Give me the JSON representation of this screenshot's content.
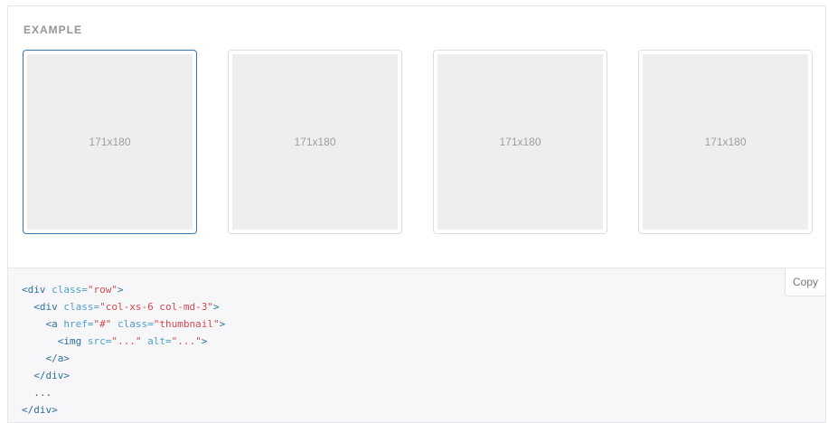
{
  "example": {
    "label": "EXAMPLE",
    "thumbnails": [
      {
        "text": "171x180",
        "active": true
      },
      {
        "text": "171x180",
        "active": false
      },
      {
        "text": "171x180",
        "active": false
      },
      {
        "text": "171x180",
        "active": false
      }
    ]
  },
  "code_block": {
    "copy_label": "Copy",
    "lines": [
      [
        {
          "t": "tag",
          "v": "<div "
        },
        {
          "t": "attr",
          "v": "class="
        },
        {
          "t": "str",
          "v": "\"row\""
        },
        {
          "t": "tag",
          "v": ">"
        }
      ],
      [
        {
          "t": "plain",
          "v": "  "
        },
        {
          "t": "tag",
          "v": "<div "
        },
        {
          "t": "attr",
          "v": "class="
        },
        {
          "t": "str",
          "v": "\"col-xs-6 col-md-3\""
        },
        {
          "t": "tag",
          "v": ">"
        }
      ],
      [
        {
          "t": "plain",
          "v": "    "
        },
        {
          "t": "tag",
          "v": "<a "
        },
        {
          "t": "attr",
          "v": "href="
        },
        {
          "t": "str",
          "v": "\"#\""
        },
        {
          "t": "attr",
          "v": " class="
        },
        {
          "t": "str",
          "v": "\"thumbnail\""
        },
        {
          "t": "tag",
          "v": ">"
        }
      ],
      [
        {
          "t": "plain",
          "v": "      "
        },
        {
          "t": "tag",
          "v": "<img "
        },
        {
          "t": "attr",
          "v": "src="
        },
        {
          "t": "str",
          "v": "\"...\""
        },
        {
          "t": "attr",
          "v": " alt="
        },
        {
          "t": "str",
          "v": "\"...\""
        },
        {
          "t": "tag",
          "v": ">"
        }
      ],
      [
        {
          "t": "plain",
          "v": "    "
        },
        {
          "t": "tag",
          "v": "</a>"
        }
      ],
      [
        {
          "t": "plain",
          "v": "  "
        },
        {
          "t": "tag",
          "v": "</div>"
        }
      ],
      [
        {
          "t": "plain",
          "v": "  ..."
        }
      ],
      [
        {
          "t": "tag",
          "v": "</div>"
        }
      ]
    ]
  },
  "colors": {
    "active_border": "#337ab7",
    "tag": "#2f6f9f",
    "attribute": "#4f9fcf",
    "string": "#d44950"
  }
}
